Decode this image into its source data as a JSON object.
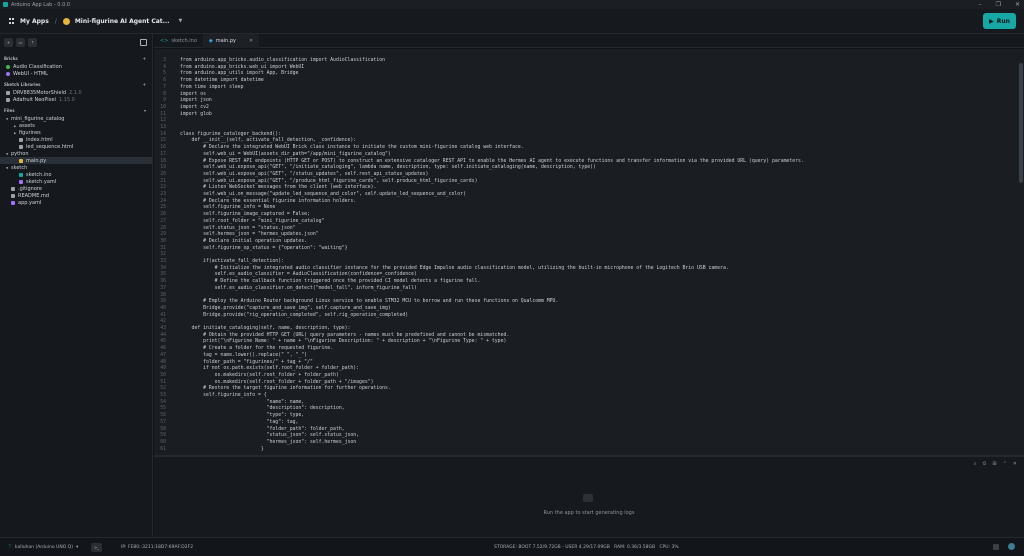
{
  "window": {
    "title": "Arduino App Lab - 0.0.0",
    "controls": [
      "–",
      "❐",
      "✕"
    ]
  },
  "header": {
    "apps_label": "My Apps",
    "separator": "/",
    "app_name": "Mini-figurine AI Agent Cat...",
    "run_label": "Run"
  },
  "sidebar": {
    "bricks_heading": "Bricks",
    "bricks": [
      {
        "label": "Audio Classification",
        "color": "#3fb950"
      },
      {
        "label": "WebUI - HTML",
        "color": "#a371f7"
      }
    ],
    "libraries_heading": "Sketch Libraries",
    "libraries": [
      {
        "label": "DRV8835MotorShield",
        "version": "2.1.0"
      },
      {
        "label": "Adafruit NeoPixel",
        "version": "1.15.0"
      }
    ],
    "files_heading": "Files",
    "files": [
      {
        "label": "mini_figurine_catalog",
        "depth": 0,
        "arrow": "▼",
        "color": ""
      },
      {
        "label": "assets",
        "depth": 1,
        "arrow": "▶",
        "color": ""
      },
      {
        "label": "figurines",
        "depth": 1,
        "arrow": "▶",
        "color": ""
      },
      {
        "label": "index.html",
        "depth": 1,
        "arrow": "",
        "color": "#9aa3ab"
      },
      {
        "label": "led_sequence.html",
        "depth": 1,
        "arrow": "",
        "color": "#9aa3ab"
      },
      {
        "label": "python",
        "depth": 0,
        "arrow": "▼",
        "color": ""
      },
      {
        "label": "main.py",
        "depth": 1,
        "arrow": "",
        "color": "#e3b341",
        "selected": true
      },
      {
        "label": "sketch",
        "depth": 0,
        "arrow": "▼",
        "color": ""
      },
      {
        "label": "sketch.ino",
        "depth": 1,
        "arrow": "",
        "color": "#11a7a2"
      },
      {
        "label": "sketch.yaml",
        "depth": 1,
        "arrow": "",
        "color": "#a371f7"
      },
      {
        "label": ".gitignore",
        "depth": 0,
        "arrow": "",
        "color": "#9aa3ab"
      },
      {
        "label": "README.md",
        "depth": 0,
        "arrow": "",
        "color": "#9aa3ab"
      },
      {
        "label": "app.yaml",
        "depth": 0,
        "arrow": "",
        "color": "#a371f7"
      }
    ]
  },
  "tabs": [
    {
      "label": "sketch.ino",
      "icon": "<>",
      "active": false
    },
    {
      "label": "main.py",
      "icon": "◆",
      "active": true
    }
  ],
  "code": [
    [
      "3",
      "from arduino.app_bricks.audio_classification import AudioClassification"
    ],
    [
      "4",
      "from arduino.app_bricks.web_ui import WebUI"
    ],
    [
      "5",
      "from arduino.app_utils import App, Bridge"
    ],
    [
      "6",
      "from datetime import datetime"
    ],
    [
      "7",
      "from time import sleep"
    ],
    [
      "8",
      "import os"
    ],
    [
      "9",
      "import json"
    ],
    [
      "10",
      "import cv2"
    ],
    [
      "11",
      "import glob"
    ],
    [
      "12",
      ""
    ],
    [
      "13",
      ""
    ],
    [
      "14",
      "class figurine_cataloger_backend():"
    ],
    [
      "15",
      "    def __init__(self, activate_fall_detection, _confidence):"
    ],
    [
      "16",
      "        # Declare the integrated WebUI Brick class instance to initiate the custom mini-figurine catalog web interface."
    ],
    [
      "17",
      "        self.web_ui = WebUI(assets_dir_path=\"/app/mini_figurine_catalog\")"
    ],
    [
      "18",
      "        # Expose REST API endpoints (HTTP GET or POST) to construct an extensive cataloger REST API to enable the Hermes AI agent to execute functions and transfer information via the provided URL (query) parameters."
    ],
    [
      "19",
      "        self.web_ui.expose_api(\"GET\", \"/initiate_cataloging\", lambda name, description, type: self.initiate_cataloging(name, description, type))"
    ],
    [
      "20",
      "        self.web_ui.expose_api(\"GET\", \"/status_updates\", self.rest_api_status_updates)"
    ],
    [
      "21",
      "        self.web_ui.expose_api(\"GET\", \"/produce_html_figurine_cards\", self.produce_html_figurine_cards)"
    ],
    [
      "22",
      "        # Listen WebSocket messages from the client (web interface)."
    ],
    [
      "23",
      "        self.web_ui.on_message(\"update_led_sequence_and_color\", self.update_led_sequence_and_color)"
    ],
    [
      "24",
      "        # Declare the essential figurine information holders."
    ],
    [
      "25",
      "        self.figurine_info = None"
    ],
    [
      "26",
      "        self.figurine_image_captured = False;"
    ],
    [
      "27",
      "        self.root_folder = \"mini_figurine_catalog\""
    ],
    [
      "28",
      "        self.status_json = \"status.json\""
    ],
    [
      "29",
      "        self.hermes_json = \"hermes_updates.json\""
    ],
    [
      "30",
      "        # Declare initial operation updates."
    ],
    [
      "31",
      "        self.figurine_op_status = {\"operation\": \"waiting\"}"
    ],
    [
      "32",
      ""
    ],
    [
      "33",
      "        if(activate_fall_detection):"
    ],
    [
      "34",
      "            # Initialize the integrated audio classifier instance for the provided Edge Impulse audio classification model, utilizing the built-in microphone of the Logitech Brio USB camera."
    ],
    [
      "35",
      "            self.es_audio_classifier = AudioClassification(confidence=_confidence)"
    ],
    [
      "36",
      "            # Define the callback function triggered once the provided CI model detects a figurine fall."
    ],
    [
      "37",
      "            self.es_audio_classifier.on_detect(\"model_fall\", inform_figurine_fall)"
    ],
    [
      "38",
      ""
    ],
    [
      "39",
      "        # Employ the Arduino Router background Linux service to enable STM32 MCU to borrow and run these functions on Qualcomm MPU."
    ],
    [
      "40",
      "        Bridge.provide(\"capture_and_save_img\", self.capture_and_save_img)"
    ],
    [
      "41",
      "        Bridge.provide(\"rig_operation_completed\", self.rig_operation_completed)"
    ],
    [
      "42",
      ""
    ],
    [
      "43",
      "    def initiate_cataloging(self, name, description, type):"
    ],
    [
      "44",
      "        # Obtain the provided HTTP GET (URL) query parameters - names must be predefined and cannot be mismatched."
    ],
    [
      "45",
      "        print(\"\\nFigurine Name: \" + name + \"\\nFigurine Description: \" + description + \"\\nFigurine Type: \" + type)"
    ],
    [
      "46",
      "        # Create a folder for the requested figurine."
    ],
    [
      "47",
      "        tag = name.lower().replace(\" \", \"_\")"
    ],
    [
      "48",
      "        folder_path = \"figurines/\" + tag + \"/\""
    ],
    [
      "49",
      "        if not os.path.exists(self.root_folder + folder_path):"
    ],
    [
      "50",
      "            os.makedirs(self.root_folder + folder_path)"
    ],
    [
      "51",
      "            os.makedirs(self.root_folder + folder_path + \"/images\")"
    ],
    [
      "52",
      "        # Restore the target figurine information for further operations."
    ],
    [
      "53",
      "        self.figurine_info = {"
    ],
    [
      "54",
      "                              \"name\": name,"
    ],
    [
      "55",
      "                              \"description\": description,"
    ],
    [
      "56",
      "                              \"type\": type,"
    ],
    [
      "57",
      "                              \"tag\": tag,"
    ],
    [
      "58",
      "                              \"folder_path\": folder_path,"
    ],
    [
      "59",
      "                              \"status_json\": self.status_json,"
    ],
    [
      "60",
      "                              \"hermes_json\": self.hermes_json"
    ],
    [
      "61",
      "                            }"
    ]
  ],
  "console": {
    "message": "Run the app to start generating logs",
    "controls": [
      "⌕",
      "⏲",
      "⊞",
      "⌃",
      "✕"
    ]
  },
  "statusbar": {
    "board": "kalluhan (Arduino UNO Q)",
    "ip": "IP: FE80::3211:18D7:69AF:D2F2",
    "storage": "STORAGE: BOOT 7.52/9.72GB - USER 4.29/17.09GB",
    "ram": "RAM: 0.36/3.58GB",
    "cpu": "CPU: 3%"
  }
}
